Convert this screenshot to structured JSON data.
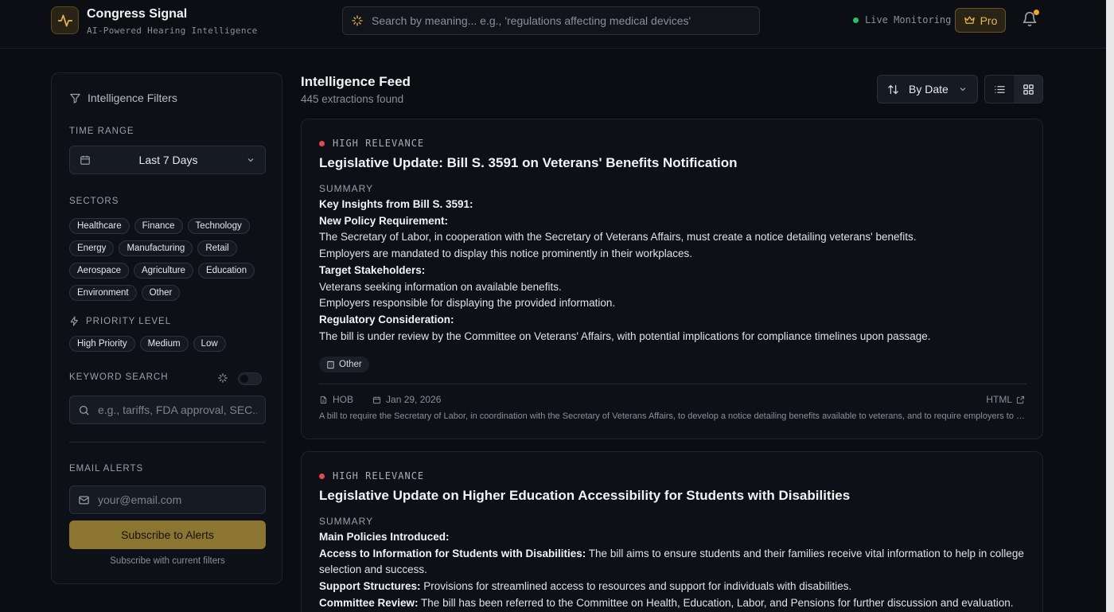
{
  "header": {
    "title": "Congress Signal",
    "subtitle": "AI-Powered Hearing Intelligence",
    "search_placeholder": "Search by meaning... e.g., 'regulations affecting medical devices'",
    "live_label": "Live Monitoring",
    "pro_label": "Pro"
  },
  "sidebar": {
    "title": "Intelligence Filters",
    "time_range_label": "TIME RANGE",
    "time_range_value": "Last 7 Days",
    "sectors_label": "SECTORS",
    "sectors": [
      "Healthcare",
      "Finance",
      "Technology",
      "Energy",
      "Manufacturing",
      "Retail",
      "Aerospace",
      "Agriculture",
      "Education",
      "Environment",
      "Other"
    ],
    "priority_label": "PRIORITY LEVEL",
    "priorities": [
      "High Priority",
      "Medium",
      "Low"
    ],
    "keyword_label": "KEYWORD SEARCH",
    "keyword_placeholder": "e.g., tariffs, FDA approval, SEC...",
    "email_label": "EMAIL ALERTS",
    "email_placeholder": "your@email.com",
    "subscribe_label": "Subscribe to Alerts",
    "subscribe_note": "Subscribe with current filters"
  },
  "feed": {
    "title": "Intelligence Feed",
    "count": "445 extractions found",
    "sort_label": "By Date"
  },
  "cards": [
    {
      "relevance": "HIGH RELEVANCE",
      "title": "Legislative Update: Bill S. 3591 on Veterans' Benefits Notification",
      "summary_label": "SUMMARY",
      "lines": [
        {
          "bold": "Key Insights from Bill S. 3591:",
          "text": ""
        },
        {
          "bold": "New Policy Requirement:",
          "text": ""
        },
        {
          "bold": "",
          "text": "The Secretary of Labor, in cooperation with the Secretary of Veterans Affairs, must create a notice detailing veterans' benefits."
        },
        {
          "bold": "",
          "text": "Employers are mandated to display this notice prominently in their workplaces."
        },
        {
          "bold": "Target Stakeholders:",
          "text": ""
        },
        {
          "bold": "",
          "text": "Veterans seeking information on available benefits."
        },
        {
          "bold": "",
          "text": "Employers responsible for displaying the provided information."
        },
        {
          "bold": "Regulatory Consideration:",
          "text": ""
        },
        {
          "bold": "",
          "text": "The bill is under review by the Committee on Veterans' Affairs, with potential implications for compliance timelines upon passage."
        }
      ],
      "tag": "Other",
      "source": "HOB",
      "date": "Jan 29, 2026",
      "link": "HTML",
      "description": "A bill to require the Secretary of Labor, in coordination with the Secretary of Veterans Affairs, to develop a notice detailing benefits available to veterans, and to require employers to display the notice."
    },
    {
      "relevance": "HIGH RELEVANCE",
      "title": "Legislative Update on Higher Education Accessibility for Students with Disabilities",
      "summary_label": "SUMMARY",
      "lines": [
        {
          "bold": "Main Policies Introduced:",
          "text": ""
        },
        {
          "bold": "Access to Information for Students with Disabilities:",
          "text": " The bill aims to ensure students and their families receive vital information to help in college selection and success."
        },
        {
          "bold": "Support Structures:",
          "text": " Provisions for streamlined access to resources and support for individuals with disabilities."
        },
        {
          "bold": "Committee Review:",
          "text": " The bill has been referred to the Committee on Health, Education, Labor, and Pensions for further discussion and evaluation."
        }
      ]
    }
  ],
  "colors": {
    "accent_gold": "#e6b84a",
    "subscribe_bg": "#8c7431",
    "live_green": "#22c55e",
    "relevance_red": "#e5484d",
    "notification": "#f5a524"
  }
}
